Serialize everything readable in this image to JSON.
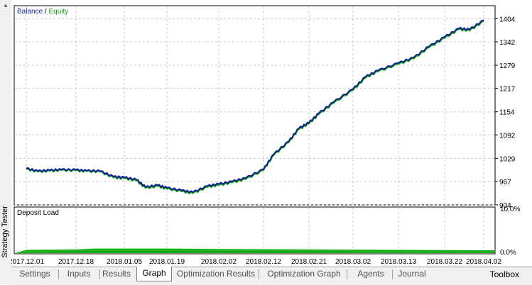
{
  "window": {
    "side_title": "Strategy Tester",
    "toolbox_label": "Toolbox"
  },
  "tabs": [
    {
      "label": "Settings",
      "active": false
    },
    {
      "label": "Inputs",
      "active": false
    },
    {
      "label": "Results",
      "active": false
    },
    {
      "label": "Graph",
      "active": true
    },
    {
      "label": "Optimization Results",
      "active": false
    },
    {
      "label": "Optimization Graph",
      "active": false
    },
    {
      "label": "Agents",
      "active": false
    },
    {
      "label": "Journal",
      "active": false
    }
  ],
  "colors": {
    "balance": "#0a1f8f",
    "equity": "#18a018",
    "deposit_load": "#1ab01a",
    "grid": "#c8c8c8"
  },
  "chart_data": [
    {
      "type": "line",
      "legend": [
        {
          "name": "Balance",
          "color": "#0a1f8f"
        },
        {
          "name": "Equity",
          "color": "#18a018"
        }
      ],
      "legend_separator": " / ",
      "legend_placement": "top-left",
      "y_ticks": [
        904,
        967,
        1029,
        1092,
        1154,
        1217,
        1279,
        1342,
        1404
      ],
      "ylim": [
        904,
        1420
      ],
      "grid": true,
      "series": [
        {
          "name": "Balance",
          "x": [
            "2017.12.01",
            "2017.12.05",
            "2017.12.09",
            "2017.12.13",
            "2017.12.18",
            "2017.12.22",
            "2017.12.27",
            "2018.01.01",
            "2018.01.05",
            "2018.01.09",
            "2018.01.12",
            "2018.01.16",
            "2018.01.19",
            "2018.01.23",
            "2018.01.26",
            "2018.01.30",
            "2018.02.02",
            "2018.02.05",
            "2018.02.08",
            "2018.02.12",
            "2018.02.14",
            "2018.02.17",
            "2018.02.19",
            "2018.02.21",
            "2018.02.23",
            "2018.02.26",
            "2018.03.02",
            "2018.03.05",
            "2018.03.08",
            "2018.03.13",
            "2018.03.16",
            "2018.03.19",
            "2018.03.22",
            "2018.03.26",
            "2018.03.29",
            "2018.04.02"
          ],
          "values": [
            1002,
            995,
            997,
            999,
            998,
            996,
            995,
            980,
            978,
            972,
            952,
            957,
            950,
            943,
            938,
            955,
            960,
            967,
            976,
            1000,
            1040,
            1075,
            1110,
            1125,
            1150,
            1180,
            1215,
            1248,
            1265,
            1285,
            1300,
            1330,
            1355,
            1378,
            1375,
            1400
          ]
        },
        {
          "name": "Equity",
          "x": [
            "2017.12.01",
            "2017.12.05",
            "2017.12.09",
            "2017.12.13",
            "2017.12.18",
            "2017.12.22",
            "2017.12.27",
            "2018.01.01",
            "2018.01.05",
            "2018.01.09",
            "2018.01.12",
            "2018.01.16",
            "2018.01.19",
            "2018.01.23",
            "2018.01.26",
            "2018.01.30",
            "2018.02.02",
            "2018.02.05",
            "2018.02.08",
            "2018.02.12",
            "2018.02.14",
            "2018.02.17",
            "2018.02.19",
            "2018.02.21",
            "2018.02.23",
            "2018.02.26",
            "2018.03.02",
            "2018.03.05",
            "2018.03.08",
            "2018.03.13",
            "2018.03.16",
            "2018.03.19",
            "2018.03.22",
            "2018.03.26",
            "2018.03.29",
            "2018.04.02"
          ],
          "values": [
            1000,
            993,
            995,
            997,
            996,
            994,
            993,
            977,
            975,
            969,
            949,
            954,
            947,
            940,
            935,
            952,
            957,
            964,
            973,
            997,
            1037,
            1072,
            1107,
            1122,
            1147,
            1177,
            1212,
            1245,
            1262,
            1282,
            1297,
            1327,
            1352,
            1375,
            1372,
            1397
          ]
        }
      ]
    },
    {
      "type": "area",
      "title": "Deposit Load",
      "y_ticks": [
        "10.0%",
        "0.0%"
      ],
      "ylim": [
        0,
        10
      ],
      "x_ticks": [
        "2017.12.01",
        "2017.12.18",
        "2018.01.05",
        "2018.01.19",
        "2018.02.02",
        "2018.02.12",
        "2018.02.21",
        "2018.03.02",
        "2018.03.13",
        "2018.03.22",
        "2018.04.02"
      ],
      "series": [
        {
          "name": "Deposit Load",
          "x": [
            "2017.12.01",
            "2017.12.18",
            "2017.12.25",
            "2018.01.19",
            "2018.02.02",
            "2018.02.21",
            "2018.03.13",
            "2018.04.02"
          ],
          "values": [
            0.9,
            1.0,
            1.2,
            1.2,
            1.1,
            1.0,
            0.9,
            0.8
          ]
        }
      ]
    }
  ]
}
